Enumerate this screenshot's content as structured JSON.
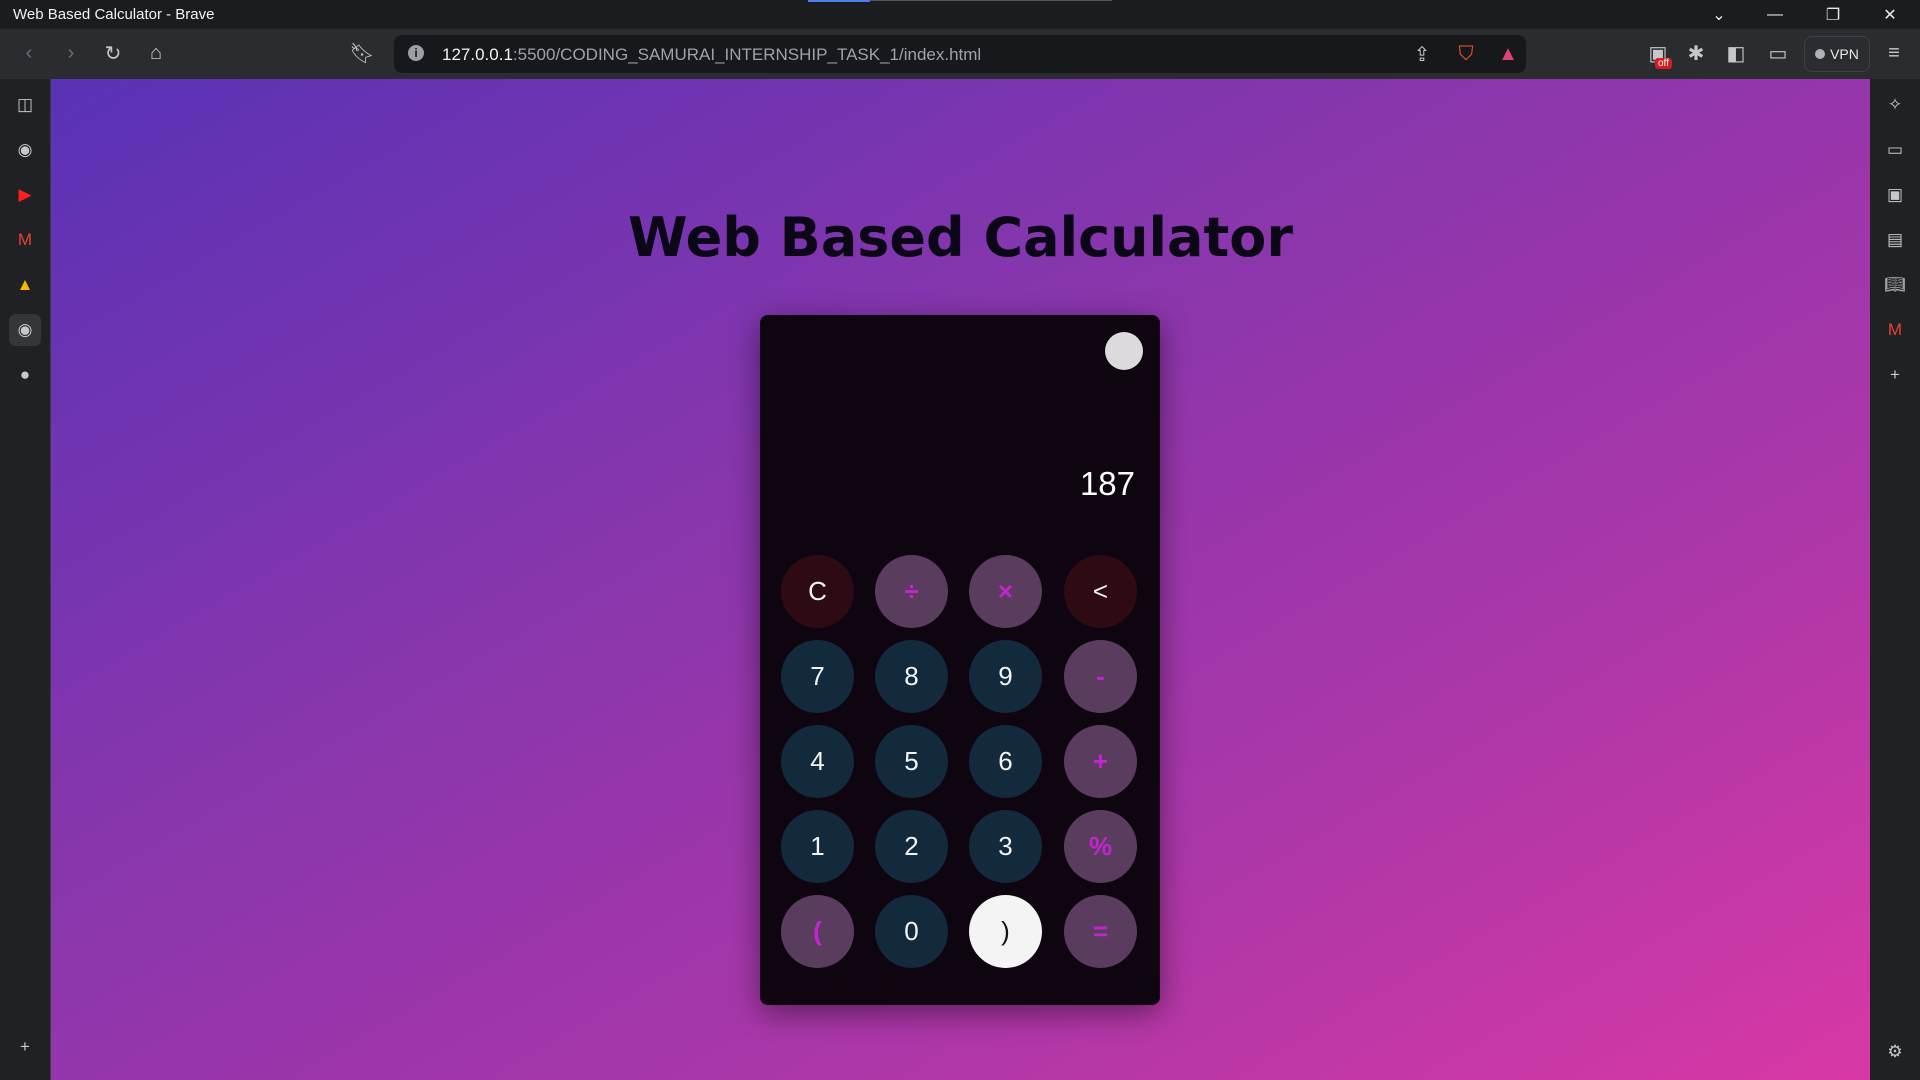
{
  "window": {
    "title": "Web Based Calculator - Brave",
    "controls": [
      "chevron-down-icon",
      "minimize-icon",
      "restore-icon",
      "close-icon"
    ]
  },
  "toolbar": {
    "url_host": "127.0.0.1",
    "url_rest": ":5500/CODING_SAMURAI_INTERNSHIP_TASK_1/index.html",
    "badge_off": "off",
    "vpn_label": "VPN"
  },
  "page": {
    "heading": "Web Based Calculator"
  },
  "calculator": {
    "display": "187",
    "keys": [
      {
        "label": "C",
        "kind": "danger"
      },
      {
        "label": "÷",
        "kind": "op"
      },
      {
        "label": "×",
        "kind": "op"
      },
      {
        "label": "<",
        "kind": "danger"
      },
      {
        "label": "7",
        "kind": "num"
      },
      {
        "label": "8",
        "kind": "num"
      },
      {
        "label": "9",
        "kind": "num"
      },
      {
        "label": "-",
        "kind": "op"
      },
      {
        "label": "4",
        "kind": "num"
      },
      {
        "label": "5",
        "kind": "num"
      },
      {
        "label": "6",
        "kind": "num"
      },
      {
        "label": "+",
        "kind": "op"
      },
      {
        "label": "1",
        "kind": "num"
      },
      {
        "label": "2",
        "kind": "num"
      },
      {
        "label": "3",
        "kind": "num"
      },
      {
        "label": "%",
        "kind": "op"
      },
      {
        "label": "(",
        "kind": "op"
      },
      {
        "label": "0",
        "kind": "num"
      },
      {
        "label": ")",
        "kind": "light"
      },
      {
        "label": "=",
        "kind": "op"
      }
    ]
  },
  "colors": {
    "num_key": "#13293c",
    "op_key": "#5a3d5e",
    "op_text": "#c424cf",
    "calc_bg": "#0e0510",
    "gradient_start": "#5932b6",
    "gradient_end": "#d838a5"
  }
}
